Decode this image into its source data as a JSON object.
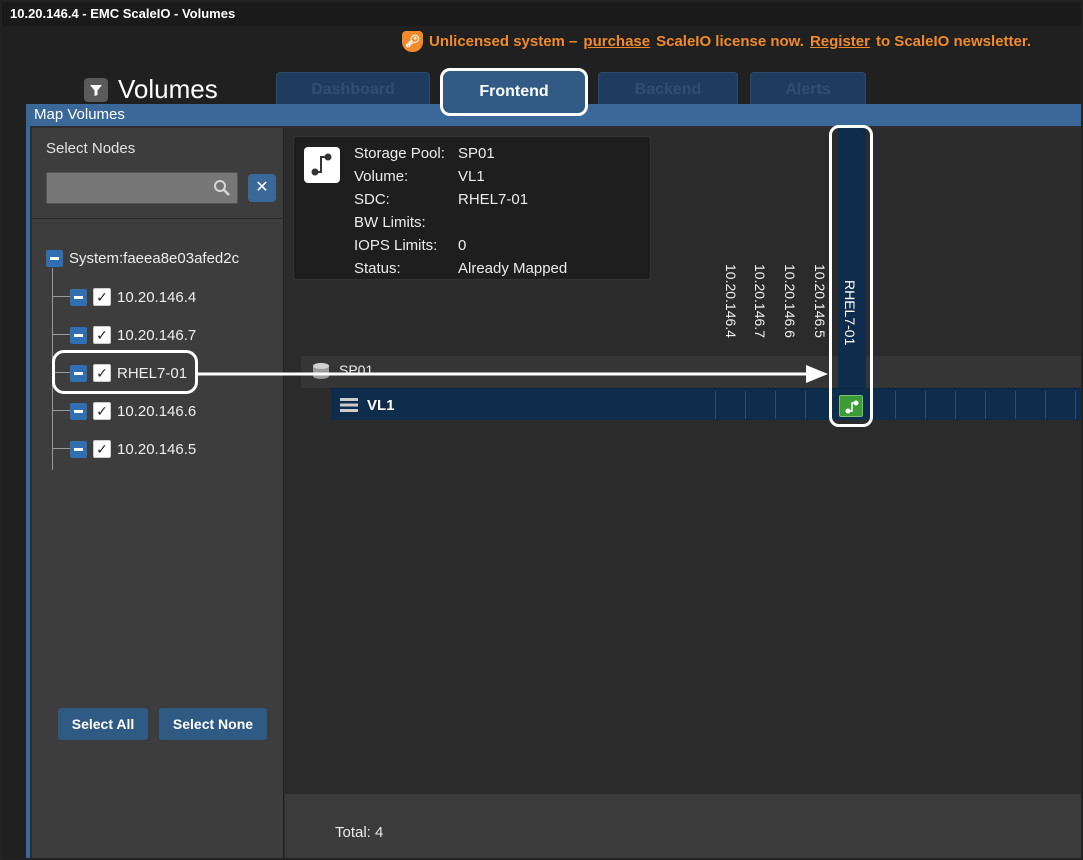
{
  "window": {
    "title": "10.20.146.4 - EMC ScaleIO - Volumes"
  },
  "banner": {
    "prefix": "Unlicensed system –",
    "purchase_link": "purchase",
    "middle": "ScaleIO license now.",
    "register_link": "Register",
    "suffix": "to ScaleIO newsletter.",
    "color": "#f08a2a"
  },
  "app": {
    "title": "Volumes"
  },
  "tabs": [
    {
      "label": "Dashboard",
      "active": false
    },
    {
      "label": "Frontend",
      "active": true
    },
    {
      "label": "Backend",
      "active": false
    },
    {
      "label": "Alerts",
      "active": false
    }
  ],
  "panel": {
    "title": "Map Volumes"
  },
  "left": {
    "select_nodes_label": "Select Nodes",
    "search_placeholder": "",
    "clear_label": "✕",
    "tree": {
      "root": "System:faeea8e03afed2c",
      "nodes": [
        "10.20.146.4",
        "10.20.146.7",
        "RHEL7-01",
        "10.20.146.6",
        "10.20.146.5"
      ]
    },
    "select_all": "Select All",
    "select_none": "Select None"
  },
  "info": {
    "rows": [
      {
        "key": "Storage Pool:",
        "value": "SP01"
      },
      {
        "key": "Volume:",
        "value": "VL1"
      },
      {
        "key": "SDC:",
        "value": "RHEL7-01"
      },
      {
        "key": "BW Limits:",
        "value": ""
      },
      {
        "key": "IOPS Limits:",
        "value": "0"
      },
      {
        "key": "Status:",
        "value": "Already Mapped"
      }
    ]
  },
  "grid": {
    "columns": [
      "10.20.146.4",
      "10.20.146.7",
      "10.20.146.6",
      "10.20.146.5"
    ],
    "selected_column": "RHEL7-01",
    "pool": "SP01",
    "volume": "VL1",
    "mapped_color": "#3b9b35"
  },
  "footer": {
    "total": "Total: 4"
  },
  "colors": {
    "accent": "#3a6898",
    "dark_row": "#0e2c4c"
  }
}
